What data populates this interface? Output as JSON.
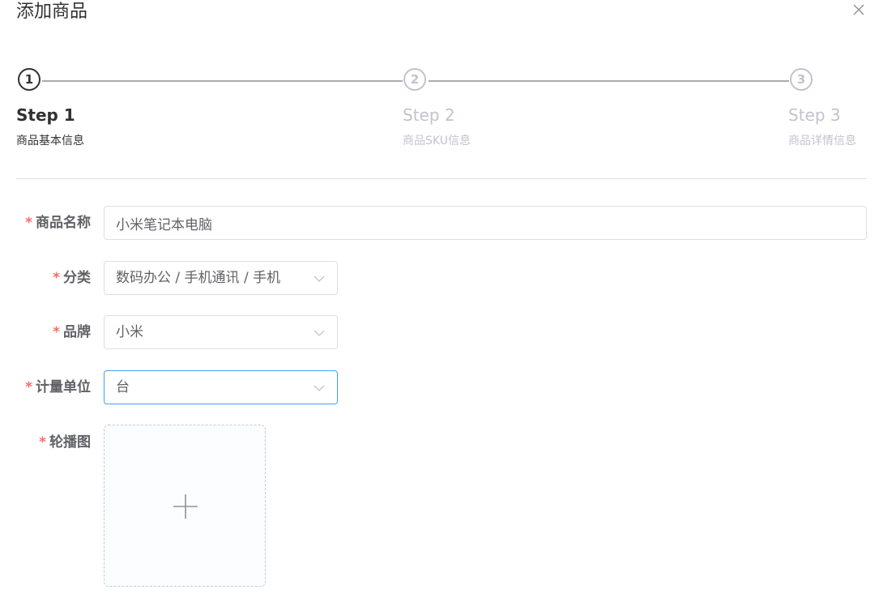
{
  "dialog": {
    "title": "添加商品"
  },
  "steps": [
    {
      "number": "1",
      "title": "Step 1",
      "description": "商品基本信息",
      "status": "active"
    },
    {
      "number": "2",
      "title": "Step 2",
      "description": "商品SKU信息",
      "status": "wait"
    },
    {
      "number": "3",
      "title": "Step 3",
      "description": "商品详情信息",
      "status": "wait"
    }
  ],
  "form": {
    "required_mark": "*",
    "name": {
      "label": "商品名称",
      "value": "小米笔记本电脑"
    },
    "category": {
      "label": "分类",
      "value": "数码办公 / 手机通讯 / 手机"
    },
    "brand": {
      "label": "品牌",
      "value": "小米"
    },
    "unit": {
      "label": "计量单位",
      "value": "台"
    },
    "carousel": {
      "label": "轮播图"
    }
  },
  "icons": {
    "close": "close-icon",
    "arrow": "chevron-down-icon",
    "upload": "plus-icon"
  },
  "colors": {
    "required": "#f56c6c",
    "focus_border": "#409eff",
    "active_step": "#303133",
    "inactive_step": "#c0c4cc"
  }
}
